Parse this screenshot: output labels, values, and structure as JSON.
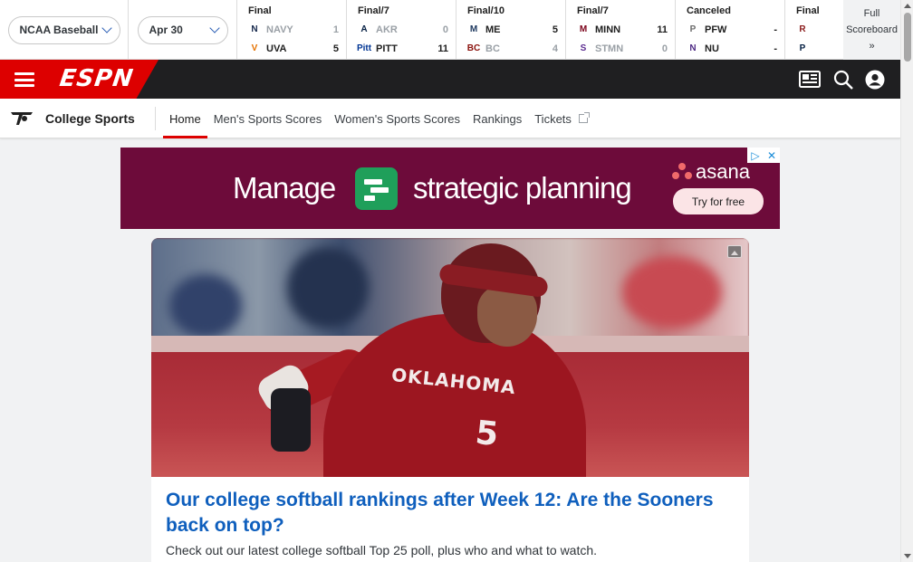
{
  "filters": {
    "sport": "NCAA Baseball",
    "date": "Apr 30"
  },
  "games": [
    {
      "status": "Final",
      "teams": [
        {
          "abbr": "NAVY",
          "score": "1",
          "winner": false,
          "logo": "N",
          "color": "#13264a"
        },
        {
          "abbr": "UVA",
          "score": "5",
          "winner": true,
          "logo": "V",
          "color": "#e57200"
        }
      ]
    },
    {
      "status": "Final/7",
      "teams": [
        {
          "abbr": "AKR",
          "score": "0",
          "winner": false,
          "logo": "A",
          "color": "#041e42"
        },
        {
          "abbr": "PITT",
          "score": "11",
          "winner": true,
          "logo": "Pitt",
          "color": "#003594"
        }
      ]
    },
    {
      "status": "Final/10",
      "teams": [
        {
          "abbr": "ME",
          "score": "5",
          "winner": true,
          "logo": "M",
          "color": "#1b365d"
        },
        {
          "abbr": "BC",
          "score": "4",
          "winner": false,
          "logo": "BC",
          "color": "#8a100b"
        }
      ]
    },
    {
      "status": "Final/7",
      "teams": [
        {
          "abbr": "MINN",
          "score": "11",
          "winner": true,
          "logo": "M",
          "color": "#7a0019"
        },
        {
          "abbr": "STMN",
          "score": "0",
          "winner": false,
          "logo": "S",
          "color": "#5c2d91"
        }
      ]
    },
    {
      "status": "Canceled",
      "teams": [
        {
          "abbr": "PFW",
          "score": "-",
          "winner": true,
          "logo": "P",
          "color": "#6b6b6b"
        },
        {
          "abbr": "NU",
          "score": "-",
          "winner": true,
          "logo": "N",
          "color": "#4e2a84"
        }
      ]
    },
    {
      "status": "Final",
      "teams": [
        {
          "abbr": "",
          "score": "",
          "winner": false,
          "logo": "R",
          "color": "#8b1c1c"
        },
        {
          "abbr": "",
          "score": "",
          "winner": false,
          "logo": "P",
          "color": "#041e42"
        }
      ]
    }
  ],
  "full_scoreboard": {
    "line1": "Full",
    "line2": "Scoreboard »"
  },
  "header": {
    "logo_text": "ESPN",
    "icons": [
      "news-icon",
      "search-icon",
      "profile-icon"
    ]
  },
  "subnav": {
    "title": "College Sports",
    "links": [
      "Home",
      "Men's Sports Scores",
      "Women's Sports Scores",
      "Rankings",
      "Tickets"
    ]
  },
  "ad": {
    "word1": "Manage",
    "word2": "strategic planning",
    "brand": "asana",
    "cta": "Try for free"
  },
  "article": {
    "jersey_text": "OKLAHOMA",
    "jersey_number": "5",
    "headline": "Our college softball rankings after Week 12: Are the Sooners back on top?",
    "dek": "Check out our latest college softball Top 25 poll, plus who and what to watch."
  },
  "colors": {
    "espn_red": "#dd0000",
    "nav_dark": "#1f1f21",
    "link_blue": "#0f5fbd",
    "ad_background": "#6d0b3a"
  }
}
